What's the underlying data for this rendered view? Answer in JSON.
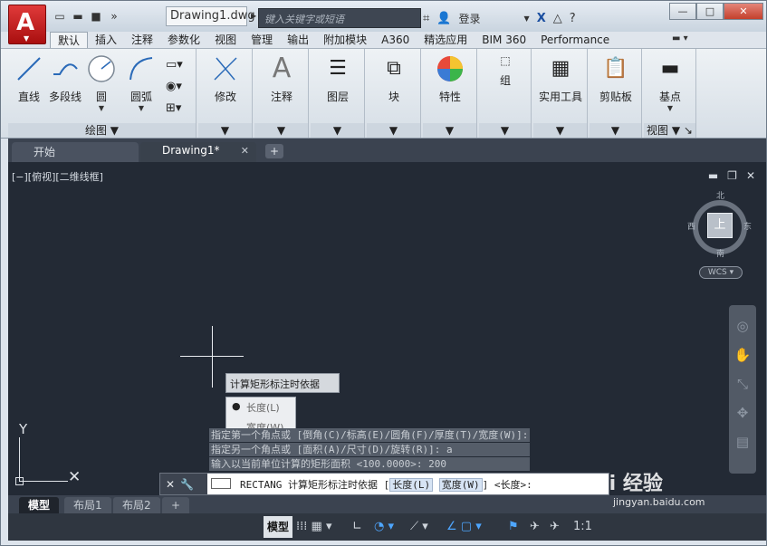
{
  "title": {
    "document": "Drawing1.dwg",
    "search_placeholder": "键入关键字或短语",
    "login": "登录"
  },
  "window": {
    "minimize": "□",
    "restore": "□",
    "close": "✕"
  },
  "ribbon_tabs": [
    "默认",
    "插入",
    "注释",
    "参数化",
    "视图",
    "管理",
    "输出",
    "附加模块",
    "A360",
    "精选应用",
    "BIM 360",
    "Performance"
  ],
  "ribbon": {
    "draw_tools": [
      "直线",
      "多段线",
      "圆",
      "圆弧"
    ],
    "draw_panel_title": "绘图",
    "modify": "修改",
    "annotate": "注释",
    "layers": "图层",
    "block": "块",
    "properties": "特性",
    "groups": "组",
    "utilities": "实用工具",
    "clipboard": "剪贴板",
    "basepoint": "基点",
    "view_panel_title": "视图"
  },
  "doc_tabs": {
    "start": "开始",
    "drawing": "Drawing1*"
  },
  "viewport": {
    "label": "[−][俯视][二维线框]",
    "viewcube": {
      "face": "上",
      "north": "北",
      "south": "南",
      "east": "东",
      "west": "西"
    },
    "wcs": "WCS"
  },
  "prompt": {
    "tooltip": "计算矩形标注时依据",
    "option_length": "长度(L)",
    "option_width": "宽度(W)"
  },
  "history": [
    "指定第一个角点或 [倒角(C)/标高(E)/圆角(F)/厚度(T)/宽度(W)]:",
    "指定另一个角点或 [面积(A)/尺寸(D)/旋转(R)]: a",
    "输入以当前单位计算的矩形面积 <100.0000>:  200"
  ],
  "command": {
    "prefix": "RECTANG 计算矩形标注时依据 [",
    "key1": "长度(L)",
    "key2": "宽度(W)",
    "suffix": "] <长度>:"
  },
  "layout_tabs": [
    "模型",
    "布局1",
    "布局2"
  ],
  "status": {
    "model": "模型",
    "scale": "1:1"
  },
  "watermark": {
    "brand": "Bai 经验",
    "url": "jingyan.baidu.com"
  }
}
